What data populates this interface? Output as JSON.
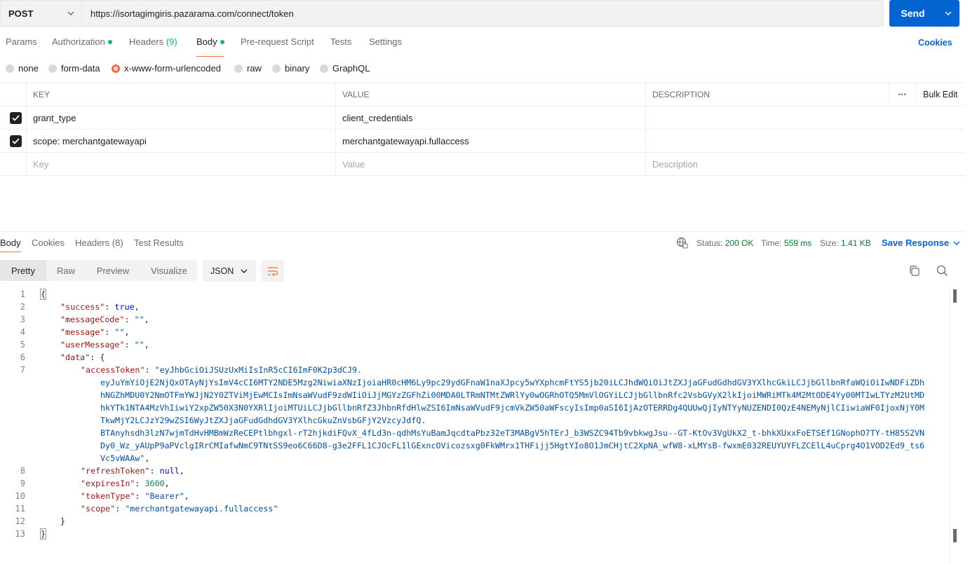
{
  "request": {
    "method": "POST",
    "url": "https://isortagimgiris.pazarama.com/connect/token",
    "send_label": "Send"
  },
  "request_tabs": [
    {
      "label": "Params"
    },
    {
      "label": "Authorization"
    },
    {
      "label": "Headers",
      "count": "(9)"
    },
    {
      "label": "Body"
    },
    {
      "label": "Pre-request Script"
    },
    {
      "label": "Tests"
    },
    {
      "label": "Settings"
    }
  ],
  "cookies_label": "Cookies",
  "body_types": [
    "none",
    "form-data",
    "x-www-form-urlencoded",
    "raw",
    "binary",
    "GraphQL"
  ],
  "selected_body_type": "x-www-form-urlencoded",
  "params": {
    "headers": {
      "key": "KEY",
      "value": "VALUE",
      "description": "DESCRIPTION",
      "more": "•••",
      "bulk_edit": "Bulk Edit"
    },
    "rows": [
      {
        "key": "grant_type",
        "value": "client_credentials",
        "description": ""
      },
      {
        "key": "scope: merchantgatewayapi",
        "value": "merchantgatewayapi.fullaccess",
        "description": ""
      }
    ],
    "placeholders": {
      "key": "Key",
      "value": "Value",
      "description": "Description"
    }
  },
  "response": {
    "tabs": [
      {
        "label": "Body"
      },
      {
        "label": "Cookies"
      },
      {
        "label": "Headers",
        "count": "(8)"
      },
      {
        "label": "Test Results"
      }
    ],
    "status_label": "Status:",
    "status_value": "200 OK",
    "time_label": "Time:",
    "time_value": "559 ms",
    "size_label": "Size:",
    "size_value": "1.41 KB",
    "save_label": "Save Response",
    "views": [
      "Pretty",
      "Raw",
      "Preview",
      "Visualize"
    ],
    "format": "JSON"
  },
  "code": {
    "line_numbers": [
      "1",
      "2",
      "3",
      "4",
      "5",
      "6",
      "7",
      "8",
      "9",
      "10",
      "11",
      "12",
      "13"
    ],
    "l1": "{",
    "l2_key": "\"success\"",
    "l2_val": "true",
    "l3_key": "\"messageCode\"",
    "l3_val": "\"\"",
    "l4_key": "\"message\"",
    "l4_val": "\"\"",
    "l5_key": "\"userMessage\"",
    "l5_val": "\"\"",
    "l6_key": "\"data\"",
    "l6_brace": "{",
    "l7_key": "\"accessToken\"",
    "token_lines": [
      "\"eyJhbGciOiJSUzUxMiIsInR5cCI6ImF0K2p3dCJ9.",
      "eyJuYmYiOjE2NjQxOTAyNjYsImV4cCI6MTY2NDE5Mzg2NiwiaXNzIjoiaHR0cHM6Ly9pc29ydGFnaW1naXJpcy5wYXphcmFtYS5jb20iLCJhdWQiOiJtZXJjaGFudGdhdGV3YXlhcGkiLCJjbGllbnRfaWQiOiIwNDFiZDh",
      "hNGZhMDU0Y2NmOTFmYWJjN2Y0ZTViMjEwMCIsImNsaWVudF9zdWIiOiJjMGYzZGFhZi00MDA0LTRmNTMtZWRlYy0wOGRhOTQ5MmVlOGYiLCJjbGllbnRfc2VsbGVyX2lkIjoiMWRiMTk4M2MtODE4Yy00MTIwLTYzM2UtMD",
      "hkYTk1NTA4MzVhIiwiY2xpZW50X3N0YXRlIjoiMTUiLCJjbGllbnRfZ3JhbnRfdHlwZSI6ImNsaWVudF9jcmVkZW50aWFscyIsImp0aSI6IjAzOTERRDg4QUUwQjIyNTYyNUZENDI0QzE4NEMyNjlCIiwiaWF0IjoxNjY0M",
      "TkwMjY2LCJzY29wZSI6WyJtZXJjaGFudGdhdGV3YXlhcGkuZnVsbGFjY2VzcyJdfQ.",
      "BTAnyhsdh3lzN7wjmTdHvHMBmWzReCEPtlbhgxl-rT2hjkdiFQvX_4fLd3n-qdhMsYuBamJqcdtaPbz32eT3MABgV5hTErJ_b3WSZC94Tb9vbkwgJsu--GT-KtOv3VgUkX2_t-bhkXUxxFoETSEf1GNophO7TY-tH85S2VN",
      "Dy0_Wz_yAUpP9aPVclgIRrCMIafwNmC9TNtSS9eo6C66D8-g3e2FFL1CJOcFL1lGExncOVicozsxg0FkWMrx1THFijj5HgtYIo8O1JmCHjtC2XpNA_wfW8-xLMYsB-fwxmE032REUYUYFLZCElL4uCprg4O1VOD2Ed9_ts6",
      "Vc5vWAAw\""
    ],
    "l8_key": "\"refreshToken\"",
    "l8_val": "null",
    "l9_key": "\"expiresIn\"",
    "l9_val": "3600",
    "l10_key": "\"tokenType\"",
    "l10_val": "\"Bearer\"",
    "l11_key": "\"scope\"",
    "l11_val": "\"merchantgatewayapi.fullaccess\"",
    "l12": "}",
    "l13": "}"
  },
  "colors": {
    "accent_orange": "#ff6c37",
    "send_blue": "#0265d2",
    "status_green": "#007f31",
    "dot_green": "#0cbb52"
  }
}
